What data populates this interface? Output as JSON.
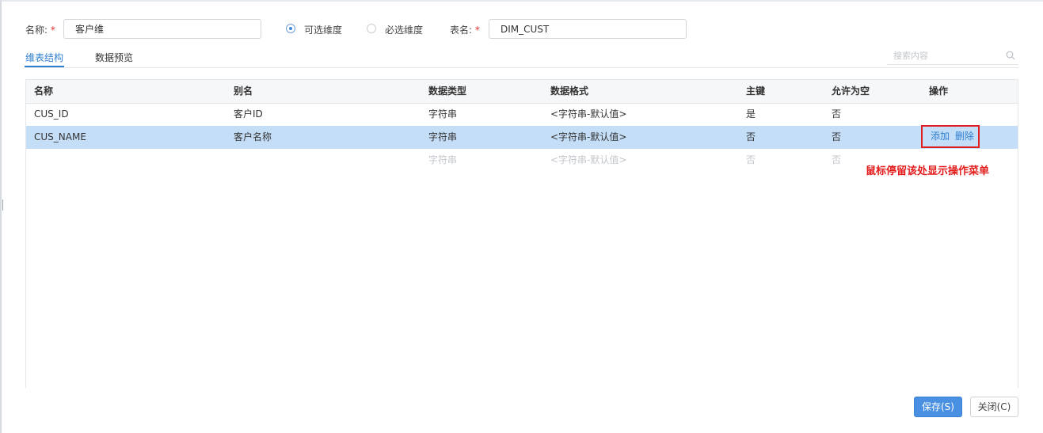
{
  "form": {
    "name_label": "名称:",
    "name_value": "客户维",
    "table_label": "表名:",
    "table_value": "DIM_CUST",
    "required_mark": "*",
    "radio_optional": "可选维度",
    "radio_required": "必选维度",
    "selected_radio": "可选维度"
  },
  "tabs": [
    {
      "label": "维表结构",
      "active": true
    },
    {
      "label": "数据预览",
      "active": false
    }
  ],
  "search": {
    "placeholder": "搜索内容"
  },
  "table": {
    "headers": [
      "名称",
      "别名",
      "数据类型",
      "数据格式",
      "主键",
      "允许为空",
      "操作"
    ],
    "rows": [
      {
        "name": "CUS_ID",
        "alias": "客户ID",
        "type": "字符串",
        "format": "<字符串-默认值>",
        "pk": "是",
        "nullable": "否"
      },
      {
        "name": "CUS_NAME",
        "alias": "客户名称",
        "type": "字符串",
        "format": "<字符串-默认值>",
        "pk": "否",
        "nullable": "否"
      }
    ],
    "placeholder_row": {
      "type": "字符串",
      "format": "<字符串-默认值>",
      "pk": "否",
      "nullable": "否"
    },
    "actions": {
      "add": "添加",
      "delete": "删除"
    }
  },
  "annotation": "鼠标停留该处显示操作菜单",
  "buttons": {
    "save": "保存(S)",
    "close": "关闭(C)"
  },
  "colors": {
    "accent": "#2f7fd1",
    "selected_row": "#c5def7",
    "primary_button": "#4a90e2",
    "annotation_red": "#e31c1c"
  },
  "icons": [
    "search-icon"
  ]
}
